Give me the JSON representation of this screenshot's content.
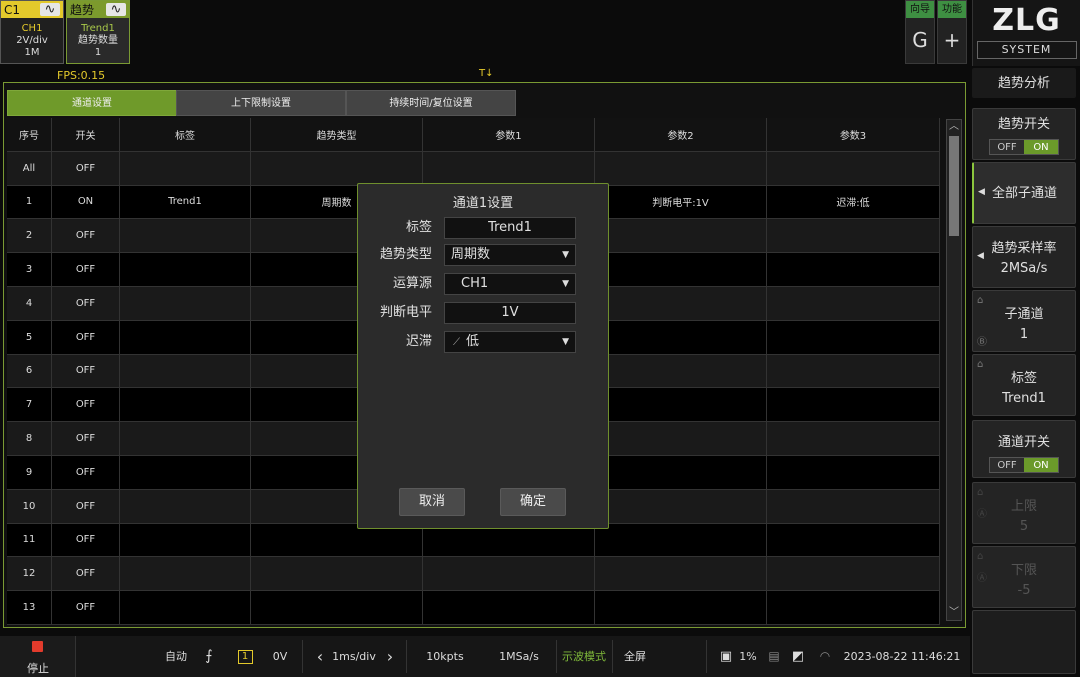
{
  "channels": [
    {
      "name": "C1",
      "lines": [
        "CH1",
        "2V/div",
        "1M"
      ]
    },
    {
      "name": "趋势",
      "lines": [
        "Trend1",
        "趋势数量",
        "1"
      ]
    }
  ],
  "top_buttons": {
    "guide_label": "向导",
    "guide_icon": "G",
    "func_label": "功能",
    "func_icon": "+"
  },
  "logo": {
    "brand": "ZLG",
    "sub": "SYSTEM"
  },
  "fps": "FPS:0.15",
  "trigger_marker": "T↓",
  "sidebar": {
    "title": "趋势分析",
    "trend_switch": {
      "label": "趋势开关",
      "off": "OFF",
      "on": "ON",
      "state": "ON"
    },
    "all_subchannels": "全部子通道",
    "sample_rate": {
      "label": "趋势采样率",
      "value": "2MSa/s"
    },
    "subchannel": {
      "label": "子通道",
      "value": "1"
    },
    "tag": {
      "label": "标签",
      "value": "Trend1"
    },
    "channel_switch": {
      "label": "通道开关",
      "off": "OFF",
      "on": "ON",
      "state": "ON"
    },
    "upper_limit": {
      "label": "上限",
      "value": "5"
    },
    "lower_limit": {
      "label": "下限",
      "value": "-5"
    }
  },
  "panel_tabs": [
    "通道设置",
    "上下限制设置",
    "持续时间/复位设置"
  ],
  "table": {
    "headers": [
      "序号",
      "开关",
      "标签",
      "趋势类型",
      "参数1",
      "参数2",
      "参数3"
    ],
    "rows": [
      [
        "All",
        "OFF",
        "",
        "",
        "",
        "",
        ""
      ],
      [
        "1",
        "ON",
        "Trend1",
        "周期数",
        "",
        "判断电平:1V",
        "迟滞:低"
      ],
      [
        "2",
        "OFF",
        "",
        "",
        "",
        "",
        ""
      ],
      [
        "3",
        "OFF",
        "",
        "",
        "",
        "",
        ""
      ],
      [
        "4",
        "OFF",
        "",
        "",
        "",
        "",
        ""
      ],
      [
        "5",
        "OFF",
        "",
        "",
        "",
        "",
        ""
      ],
      [
        "6",
        "OFF",
        "",
        "",
        "",
        "",
        ""
      ],
      [
        "7",
        "OFF",
        "",
        "",
        "",
        "",
        ""
      ],
      [
        "8",
        "OFF",
        "",
        "",
        "",
        "",
        ""
      ],
      [
        "9",
        "OFF",
        "",
        "",
        "",
        "",
        ""
      ],
      [
        "10",
        "OFF",
        "",
        "",
        "",
        "",
        ""
      ],
      [
        "11",
        "OFF",
        "",
        "",
        "",
        "",
        ""
      ],
      [
        "12",
        "OFF",
        "",
        "",
        "",
        "",
        ""
      ],
      [
        "13",
        "OFF",
        "",
        "",
        "",
        "",
        ""
      ]
    ]
  },
  "dialog": {
    "title": "通道1设置",
    "fields": [
      {
        "label": "标签",
        "value": "Trend1",
        "kind": "text"
      },
      {
        "label": "趋势类型",
        "value": "周期数",
        "kind": "select"
      },
      {
        "label": "运算源",
        "value": "CH1",
        "kind": "select"
      },
      {
        "label": "判断电平",
        "value": "1V",
        "kind": "text"
      },
      {
        "label": "迟滞",
        "value": "低",
        "kind": "select",
        "icon": "hysteresis-icon"
      }
    ],
    "cancel": "取消",
    "ok": "确定"
  },
  "bottom": {
    "stop": "停止",
    "mode": "自动",
    "trigger_channel": "1",
    "trigger_level": "0V",
    "timebase": "1ms/div",
    "memory_depth": "10kpts",
    "sample_rate": "1MSa/s",
    "display_mode": "示波模式",
    "fullscreen": "全屏",
    "cpu": "1%",
    "datetime": "2023-08-22 11:46:21"
  },
  "colors": {
    "accent": "#7c9a2d",
    "ch1": "#e3c92b",
    "stop": "#e23b2c"
  }
}
